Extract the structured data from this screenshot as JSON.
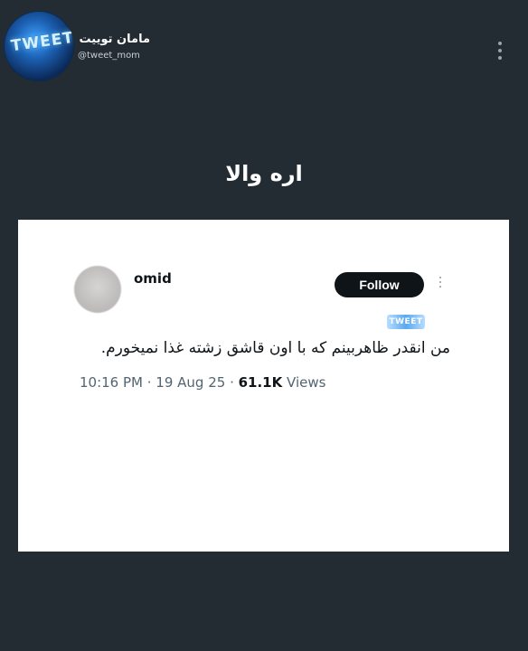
{
  "channel": {
    "name": "مامان توییت",
    "handle": "@tweet_mom",
    "avatar_text": "TWEET"
  },
  "caption": "اره والا",
  "tweet": {
    "username": "omid",
    "follow_label": "Follow",
    "sticker_text": "TWEET",
    "text": "من انقدر ظاهربینم که با اون قاشق زشته غذا نمیخورم.",
    "time": "10:16 PM",
    "sep1": " · ",
    "date": "19 Aug 25",
    "sep2": " · ",
    "views_count": "61.1K",
    "views_label": " Views"
  },
  "icons": {
    "channel_menu": "more-vertical-icon",
    "tweet_menu": "more-vertical-icon"
  }
}
